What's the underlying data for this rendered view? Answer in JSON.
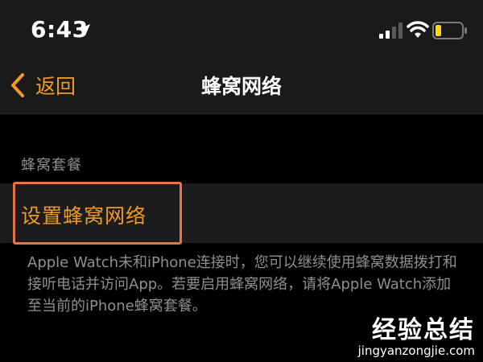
{
  "status_bar": {
    "time": "6:43"
  },
  "nav": {
    "back_label": "返回",
    "title": "蜂窝网络"
  },
  "section": {
    "header": "蜂窝套餐",
    "cell_label": "设置蜂窝网络",
    "footer": "Apple Watch未和iPhone连接时，您可以继续使用蜂窝数据拨打和接听电话并访问App。若要启用蜂窝网络，请将Apple Watch添加至当前的iPhone蜂窝套餐。"
  },
  "watermark": {
    "brand": "经验总结",
    "url": "jingyanzongjie.com"
  },
  "colors": {
    "accent": "#f39a1f",
    "highlight": "#e8744d",
    "battery": "#ffd60a"
  },
  "icons": [
    "location-arrow-icon",
    "cellular-signal-icon",
    "wifi-icon",
    "battery-icon",
    "chevron-left-icon"
  ]
}
